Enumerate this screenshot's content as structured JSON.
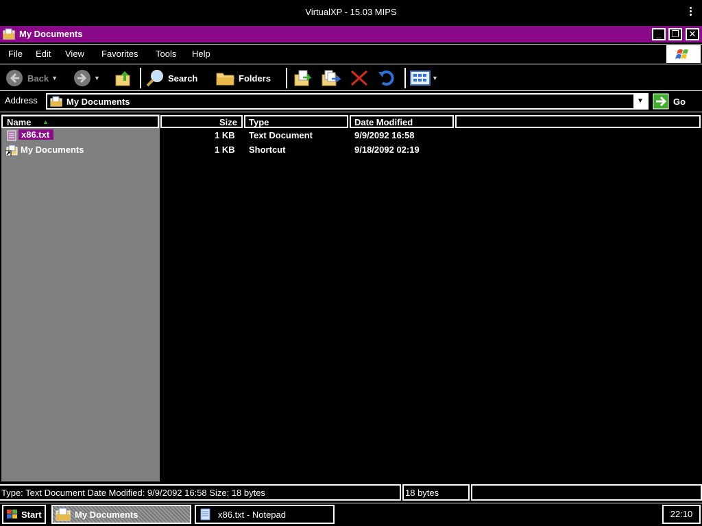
{
  "emulator": {
    "title": "VirtualXP - 15.03 MIPS",
    "menu_icon": "kebab-menu-icon"
  },
  "window": {
    "title": "My Documents",
    "controls": {
      "minimize": "_",
      "restore": "❐",
      "close": "✕"
    }
  },
  "menubar": {
    "items": [
      "File",
      "Edit",
      "View",
      "Favorites",
      "Tools",
      "Help"
    ]
  },
  "toolbar": {
    "back_label": "Back",
    "search_label": "Search",
    "folders_label": "Folders"
  },
  "address": {
    "label": "Address",
    "value": "My Documents",
    "go_label": "Go"
  },
  "columns": {
    "name": "Name",
    "size": "Size",
    "type": "Type",
    "date": "Date Modified"
  },
  "files": [
    {
      "name": "x86.txt",
      "size": "1 KB",
      "type": "Text Document",
      "date": "9/9/2092 16:58",
      "selected": true
    },
    {
      "name": "My Documents",
      "size": "1 KB",
      "type": "Shortcut",
      "date": "9/18/2092 02:19",
      "selected": false
    }
  ],
  "statusbar": {
    "details": "Type: Text Document Date Modified: 9/9/2092 16:58 Size: 18 bytes",
    "size": "18 bytes",
    "zone": ""
  },
  "taskbar": {
    "start_label": "Start",
    "tasks": [
      "My Documents",
      "x86.txt - Notepad"
    ],
    "clock": "22:10"
  },
  "colors": {
    "titlebar": "#8a0a8a",
    "selection": "#8a0a8a",
    "background": "#000000",
    "leftpane": "#808080"
  }
}
